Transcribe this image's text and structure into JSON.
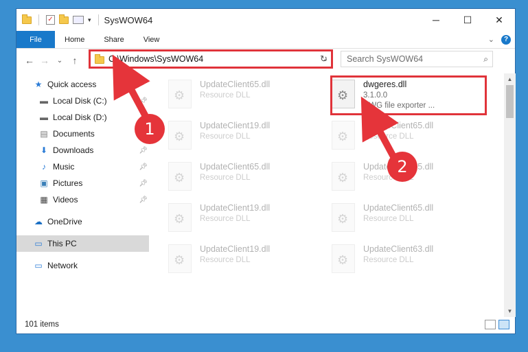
{
  "window": {
    "title": "SysWOW64",
    "controls": {
      "minimize": "─",
      "maximize": "☐",
      "close": "✕"
    }
  },
  "ribbon": {
    "tabs": [
      "File",
      "Home",
      "Share",
      "View"
    ]
  },
  "nav": {
    "back": "←",
    "forward": "→",
    "recent": "⌄",
    "up": "↑"
  },
  "address": {
    "path": "C:\\Windows\\SysWOW64"
  },
  "search": {
    "placeholder": "Search SysWOW64"
  },
  "sidebar": {
    "items": [
      {
        "label": "Quick access",
        "icon": "star-icon",
        "pinned": false
      },
      {
        "label": "Local Disk (C:)",
        "icon": "drive-icon",
        "pinned": true
      },
      {
        "label": "Local Disk (D:)",
        "icon": "drive-icon",
        "pinned": true
      },
      {
        "label": "Documents",
        "icon": "documents-icon",
        "pinned": true
      },
      {
        "label": "Downloads",
        "icon": "downloads-icon",
        "pinned": true
      },
      {
        "label": "Music",
        "icon": "music-icon",
        "pinned": true
      },
      {
        "label": "Pictures",
        "icon": "pictures-icon",
        "pinned": true
      },
      {
        "label": "Videos",
        "icon": "videos-icon",
        "pinned": true
      },
      {
        "label": "OneDrive",
        "icon": "onedrive-icon",
        "pinned": false
      },
      {
        "label": "This PC",
        "icon": "pc-icon",
        "pinned": false,
        "selected": true
      },
      {
        "label": "Network",
        "icon": "network-icon",
        "pinned": false
      }
    ]
  },
  "files": [
    {
      "name": "UpdateClient65.dll",
      "type": "Resource DLL"
    },
    {
      "name": "dwgeres.dll",
      "version": "3.1.0.0",
      "description": "DWG file exporter ..."
    },
    {
      "name": "UpdateClient19.dll",
      "type": "Resource DLL"
    },
    {
      "name": "UpdateClient65.dll",
      "type": "Resource DLL"
    },
    {
      "name": "UpdateClient65.dll",
      "type": "Resource DLL"
    },
    {
      "name": "UpdateClient65.dll",
      "type": "Resource DLL"
    },
    {
      "name": "UpdateClient19.dll",
      "type": "Resource DLL"
    },
    {
      "name": "UpdateClient65.dll",
      "type": "Resource DLL"
    },
    {
      "name": "UpdateClient19.dll",
      "type": "Resource DLL"
    },
    {
      "name": "UpdateClient63.dll",
      "type": "Resource DLL"
    }
  ],
  "status": {
    "count": "101 items"
  },
  "callouts": {
    "one": "1",
    "two": "2"
  },
  "colors": {
    "accent": "#1979ca",
    "highlight": "#e0333a",
    "desktop": "#3a8fd0"
  }
}
